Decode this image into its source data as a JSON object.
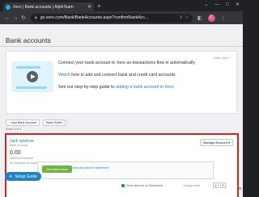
{
  "browser": {
    "tab_title": "Xero | Bank accounts | AlphiTeam",
    "tab_close": "✕",
    "new_tab": "+",
    "window_controls": [
      "⌄",
      "—",
      "□",
      "✕"
    ],
    "url": "go.xero.com/Bank/BankAccounts.aspx?confirmBankAcc...",
    "profile_initial": "C",
    "icons": [
      "back-icon",
      "forward-icon",
      "reload-icon",
      "lock-icon",
      "share-icon",
      "star-icon",
      "extensions-icon",
      "menu-icon"
    ]
  },
  "page": {
    "title": "Bank accounts",
    "promo": {
      "hide_label": "Hide now ×",
      "line1": "Connect your bank account to Xero so transactions flow in automatically",
      "line2_link": "Watch",
      "line2_rest": " how to add and connect bank and credit card accounts",
      "line3_text": "See our step-by-step guide to ",
      "line3_link": "adding a bank account in Xero"
    },
    "buttons": {
      "add_bank_account": "Add Bank Account",
      "bank_rules": "Bank Rules"
    },
    "sort_label": "Reset Sort ▾",
    "account": {
      "name": "Jack sparrow",
      "sub": "Bank account",
      "manage": "Manage Account ▾",
      "amount": "0.00",
      "statement_label": "Statement balance",
      "no_transactions": "No transactions imported",
      "get_feeds": "Get bank feeds",
      "or_text": "or ",
      "manual_link": "manually import a statement",
      "show_dashboard": "Show account on Dashboard",
      "change_order": "Change order"
    },
    "setup_guide": "Setup Guide"
  },
  "colors": {
    "accent": "#1e84c6",
    "green": "#6fb43f",
    "highlight": "#e02020"
  }
}
